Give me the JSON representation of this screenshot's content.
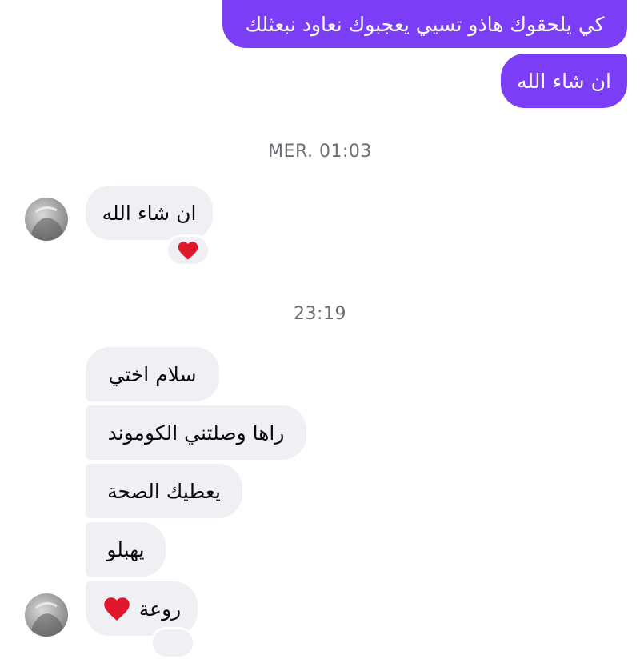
{
  "messages_sent": [
    {
      "text": "كي يلحقوك هاذو تسيي يعجبوك نعاود نبعثلك"
    },
    {
      "text": "ان شاء الله"
    }
  ],
  "timestamps": [
    "MER. 01:03",
    "23:19"
  ],
  "message_received_1": {
    "text": "ان شاء الله",
    "reaction": "heart-icon"
  },
  "messages_received_2": [
    {
      "text": "سلام اختي"
    },
    {
      "text": "راها وصلتني الكوموند"
    },
    {
      "text": "يعطيك الصحة"
    },
    {
      "text": "يهبلو"
    },
    {
      "text": "روعة"
    }
  ],
  "colors": {
    "outgoing_bubble": "#7b3df5",
    "incoming_bubble": "#efeff4",
    "timestamp_text": "#6e6e74",
    "heart": "#e0162b"
  }
}
